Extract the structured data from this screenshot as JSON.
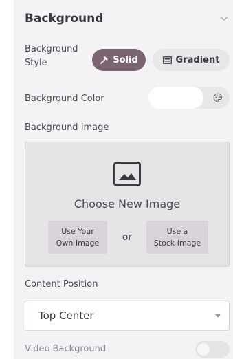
{
  "section": {
    "title": "Background",
    "collapse_icon": "chevron-down-icon"
  },
  "background_style": {
    "label_line1": "Background",
    "label_line2": "Style",
    "options": [
      {
        "label": "Solid",
        "icon": "eyedropper-icon",
        "selected": true
      },
      {
        "label": "Gradient",
        "icon": "gradient-icon",
        "selected": false
      }
    ]
  },
  "background_color": {
    "label": "Background Color",
    "value": "#ffffff",
    "icon": "palette-icon"
  },
  "background_image": {
    "label": "Background Image",
    "icon": "image-icon",
    "choose_label": "Choose New Image",
    "own_image_line1": "Use Your",
    "own_image_line2": "Own Image",
    "separator": "or",
    "stock_image_line1": "Use a",
    "stock_image_line2": "Stock Image"
  },
  "content_position": {
    "label": "Content Position",
    "value": "Top Center"
  },
  "video_background": {
    "label": "Video Background",
    "enabled": false
  },
  "colors": {
    "accent": "#7a6472",
    "panel_bg": "#f4f2f5"
  }
}
